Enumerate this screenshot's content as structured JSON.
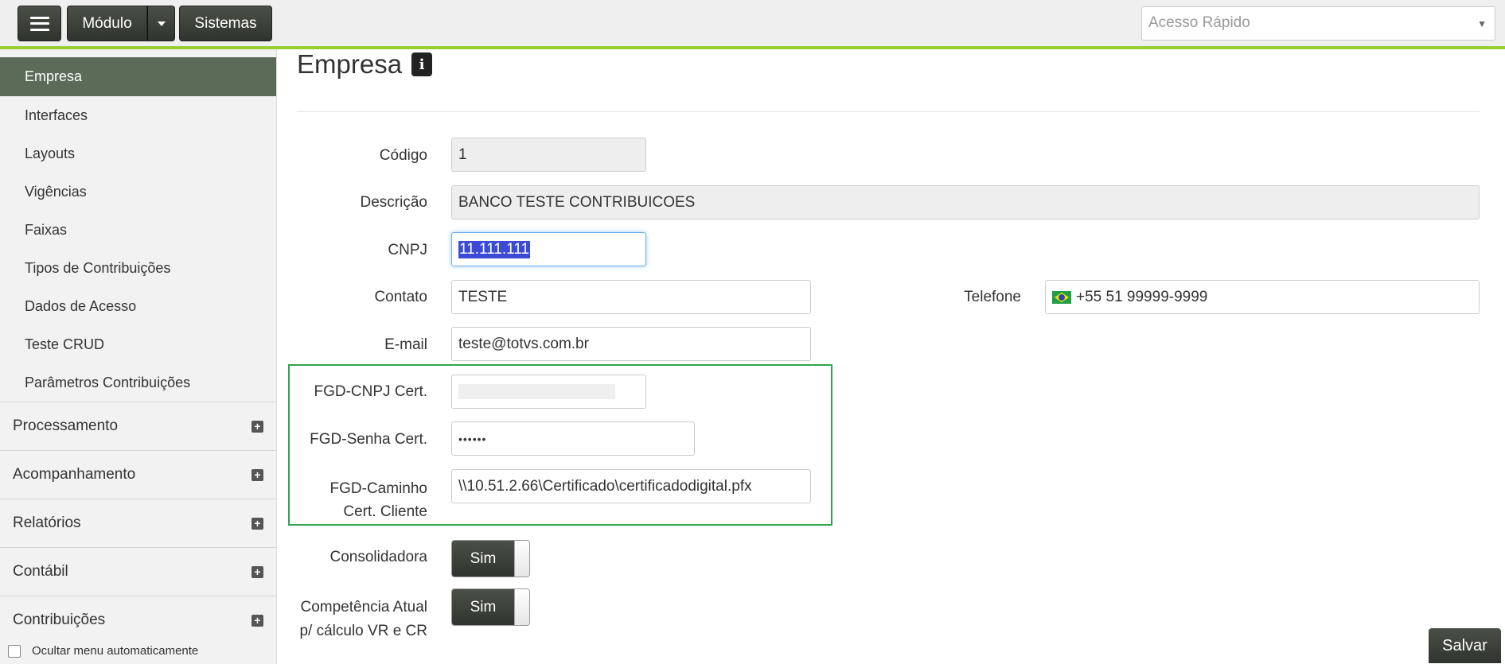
{
  "topbar": {
    "modulo_label": "Módulo",
    "sistemas_label": "Sistemas",
    "quick_placeholder": "Acesso Rápido"
  },
  "sidebar": {
    "sub_items": [
      {
        "label": "Empresa",
        "active": true
      },
      {
        "label": "Interfaces"
      },
      {
        "label": "Layouts"
      },
      {
        "label": "Vigências"
      },
      {
        "label": "Faixas"
      },
      {
        "label": "Tipos de Contribuições"
      },
      {
        "label": "Dados de Acesso"
      },
      {
        "label": "Teste CRUD"
      },
      {
        "label": "Parâmetros Contribuições"
      }
    ],
    "groups": [
      {
        "label": "Processamento"
      },
      {
        "label": "Acompanhamento"
      },
      {
        "label": "Relatórios"
      },
      {
        "label": "Contábil"
      },
      {
        "label": "Contribuições"
      }
    ],
    "hide_menu_label": "Ocultar menu automaticamente"
  },
  "page": {
    "title": "Empresa",
    "info_icon": "i"
  },
  "form": {
    "codigo": {
      "label": "Código",
      "value": "1"
    },
    "descricao": {
      "label": "Descrição",
      "value": "BANCO TESTE  CONTRIBUICOES"
    },
    "cnpj": {
      "label": "CNPJ",
      "value": "11.111.111"
    },
    "contato": {
      "label": "Contato",
      "value": "TESTE"
    },
    "telefone": {
      "label": "Telefone",
      "value": "+55 51 99999-9999"
    },
    "email": {
      "label": "E-mail",
      "value": "teste@totvs.com.br"
    },
    "fgd_cnpj": {
      "label": "FGD-CNPJ Cert.",
      "value": ""
    },
    "fgd_senha": {
      "label": "FGD-Senha Cert.",
      "value": "••••••"
    },
    "fgd_caminho": {
      "label_line1": "FGD-Caminho",
      "label_line2": "Cert. Cliente",
      "value": "\\\\10.51.2.66\\Certificado\\certificadodigital.pfx"
    },
    "consolidadora": {
      "label": "Consolidadora",
      "toggle": "Sim"
    },
    "competencia": {
      "label_line1": "Competência Atual",
      "label_line2": "p/ cálculo VR e CR",
      "toggle": "Sim"
    }
  },
  "actions": {
    "save_label": "Salvar"
  },
  "colors": {
    "accent_bar": "#9acd32",
    "highlight_box": "#2ea44f",
    "sidebar_active": "#5c6b58"
  }
}
